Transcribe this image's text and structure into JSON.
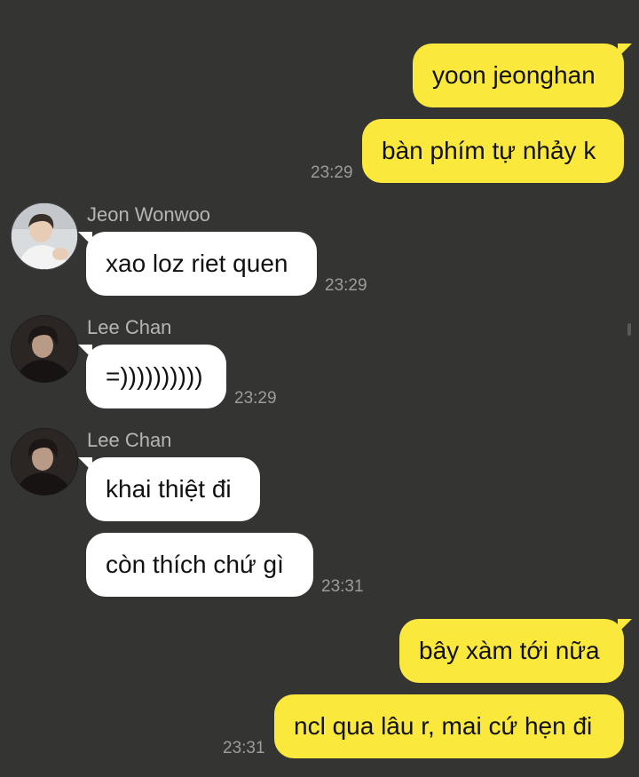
{
  "messages": {
    "m1": {
      "text": "yoon jeonghan"
    },
    "m2": {
      "text": "bàn phím tự nhảy k",
      "time": "23:29"
    },
    "m3": {
      "sender": "Jeon Wonwoo",
      "text": "xao loz riet quen",
      "time": "23:29"
    },
    "m4": {
      "sender": "Lee Chan",
      "text": "=))))))))))",
      "time": "23:29"
    },
    "m5": {
      "sender": "Lee Chan",
      "text": "khai thiệt đi"
    },
    "m6": {
      "text": "còn thích chứ gì",
      "time": "23:31"
    },
    "m7": {
      "text": "bây xàm tới nữa"
    },
    "m8": {
      "text": "ncl qua lâu r, mai cứ hẹn đi",
      "time": "23:31"
    }
  },
  "colors": {
    "background": "#343533",
    "outgoing_bubble": "#fae83c",
    "incoming_bubble": "#ffffff",
    "timestamp": "#9c9d9a",
    "sender_name": "#b5b6b3"
  },
  "icons": {
    "avatar_wonwoo": "user-avatar-photo",
    "avatar_chan": "user-avatar-photo"
  }
}
